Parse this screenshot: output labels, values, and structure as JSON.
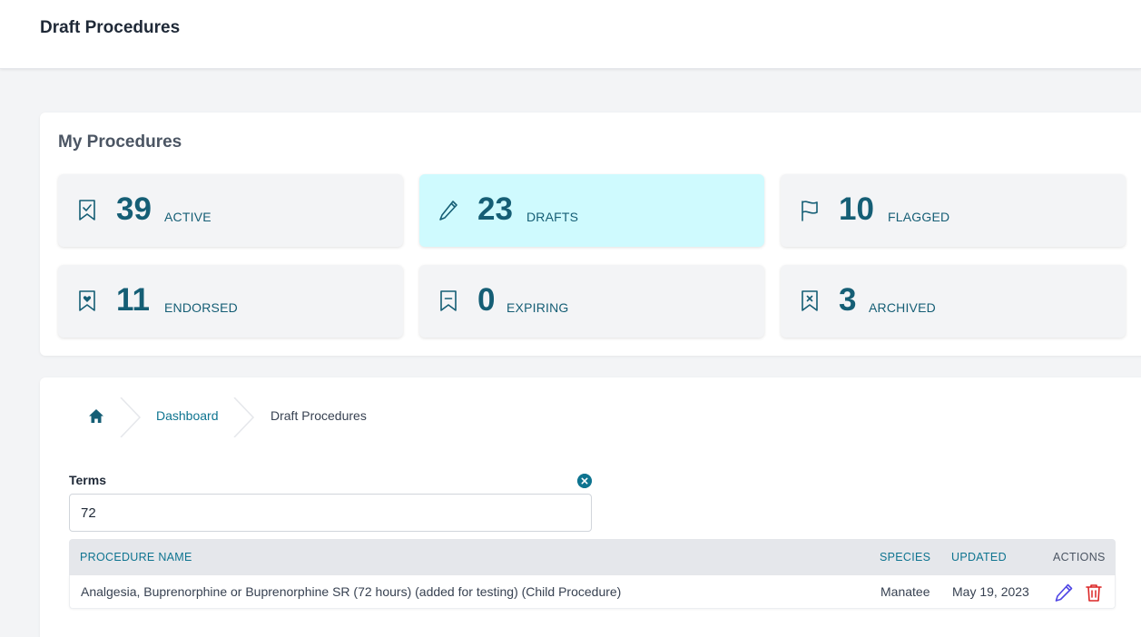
{
  "header": {
    "title": "Draft Procedures"
  },
  "stats": {
    "title": "My Procedures",
    "cards": [
      {
        "value": "39",
        "label": "ACTIVE",
        "icon": "bookmark-check-icon"
      },
      {
        "value": "23",
        "label": "DRAFTS",
        "icon": "pencil-icon",
        "selected": true
      },
      {
        "value": "10",
        "label": "FLAGGED",
        "icon": "flag-icon"
      },
      {
        "value": "11",
        "label": "ENDORSED",
        "icon": "bookmark-heart-icon"
      },
      {
        "value": "0",
        "label": "EXPIRING",
        "icon": "bookmark-dash-icon"
      },
      {
        "value": "3",
        "label": "ARCHIVED",
        "icon": "bookmark-x-icon"
      }
    ]
  },
  "breadcrumb": {
    "home_icon": "home-icon",
    "items": [
      "Dashboard",
      "Draft Procedures"
    ]
  },
  "search": {
    "label": "Terms",
    "value": "72",
    "clear_icon": "close-circle-icon"
  },
  "table": {
    "columns": [
      "PROCEDURE NAME",
      "SPECIES",
      "UPDATED",
      "ACTIONS"
    ],
    "rows": [
      {
        "name": "Analgesia, Buprenorphine or Buprenorphine SR (72 hours) (added for testing) (Child Procedure)",
        "species": "Manatee",
        "updated": "May 19, 2023"
      }
    ]
  },
  "colors": {
    "accent": "#0e7490",
    "selected_card": "#cffafe",
    "edit": "#4f46e5",
    "delete": "#dc2626"
  }
}
